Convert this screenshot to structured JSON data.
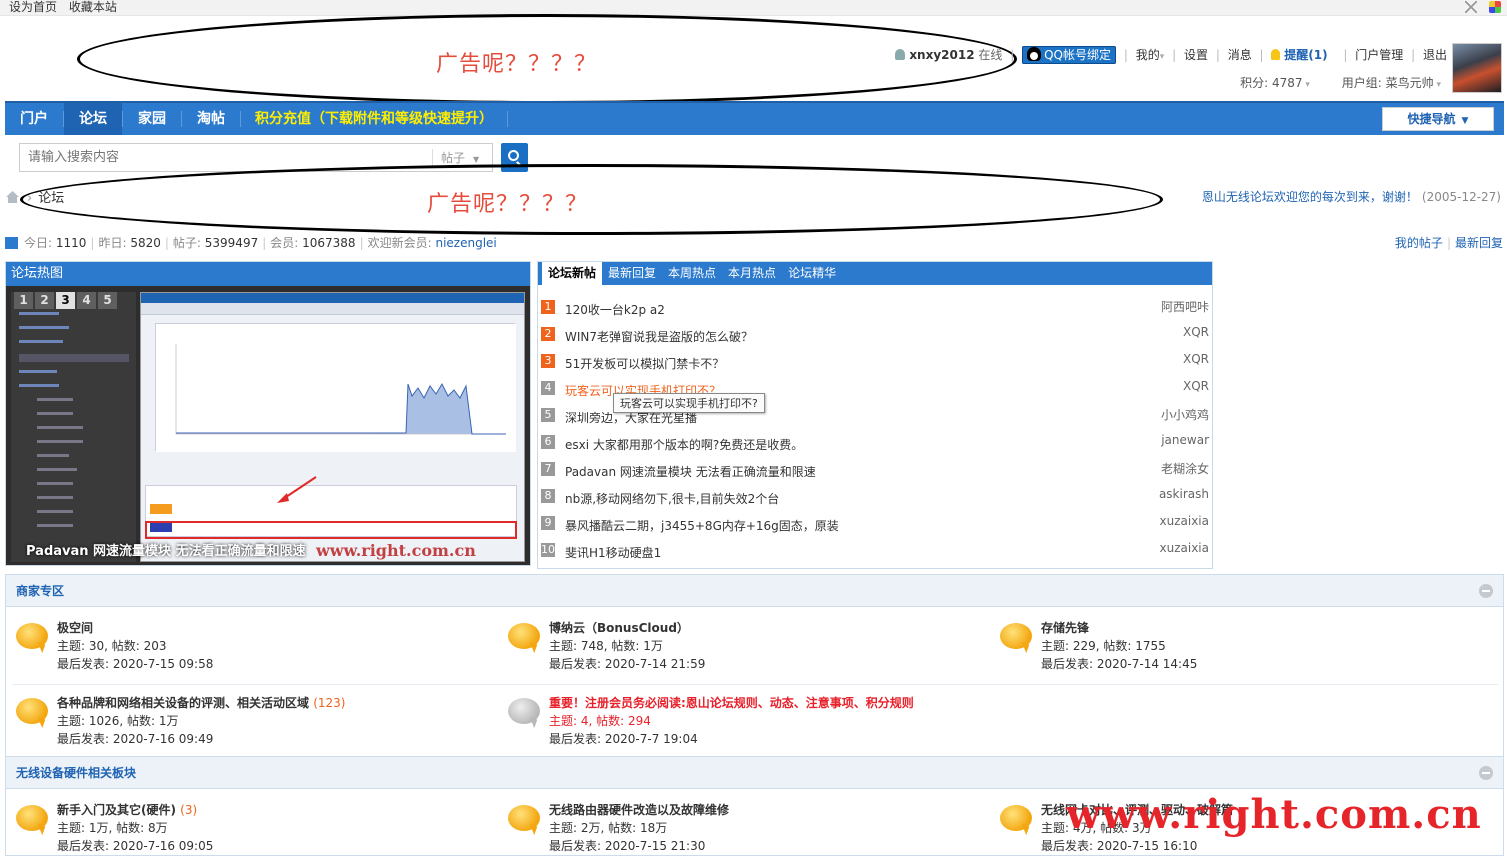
{
  "topbar": {
    "set_home": "设为首页",
    "bookmark": "收藏本站"
  },
  "ads": {
    "header_ad": "广告呢？？？？",
    "breadcrumb_ad": "广告呢？？？？"
  },
  "user": {
    "username": "xnxy2012",
    "status": "在线",
    "qq_bind": "QQ帐号绑定",
    "my": "我的",
    "settings": "设置",
    "messages": "消息",
    "reminder": "提醒(1)",
    "portal_admin": "门户管理",
    "logout": "退出",
    "points": "积分: 4787",
    "group": "用户组: 菜鸟元帅"
  },
  "nav": {
    "items": [
      "门户",
      "论坛",
      "家园",
      "淘帖"
    ],
    "promo": "积分充值（下载附件和等级快速提升）",
    "quick_nav": "快捷导航"
  },
  "search": {
    "placeholder": "请输入搜索内容",
    "type": "帖子"
  },
  "breadcrumb": {
    "current": "论坛"
  },
  "welcome": {
    "message": "恩山无线论坛欢迎您的每次到来，谢谢！",
    "date": "(2005-12-27)"
  },
  "stats": {
    "today_label": "今日: ",
    "today": "1110",
    "yesterday_label": "昨日: ",
    "yesterday": "5820",
    "posts_label": "帖子: ",
    "posts": "5399497",
    "members_label": "会员: ",
    "members": "1067388",
    "newuser_label": "欢迎新会员: ",
    "newuser": "niezenglei",
    "my_posts": "我的帖子",
    "latest_replies": "最新回复"
  },
  "hot": {
    "title": "论坛热图",
    "pages": [
      "1",
      "2",
      "3",
      "4",
      "5"
    ],
    "active_page": "3",
    "caption": "Padavan 网速流量模块 无法看正确流量和限速",
    "watermark": "www.right.com.cn"
  },
  "threads": {
    "tabs": [
      "论坛新帖",
      "最新回复",
      "本周热点",
      "本月热点",
      "论坛精华"
    ],
    "items": [
      {
        "n": "1",
        "title": "120收一台k2p a2",
        "author": "阿西吧咔"
      },
      {
        "n": "2",
        "title": "WIN7老弹窗说我是盗版的怎么破？",
        "author": "XQR"
      },
      {
        "n": "3",
        "title": "51开发板可以模拟门禁卡不？",
        "author": "XQR"
      },
      {
        "n": "4",
        "title": "玩客云可以实现手机打印不？",
        "author": "XQR"
      },
      {
        "n": "5",
        "title": "深圳旁边，大家在光星播",
        "author": "小小鸡鸡"
      },
      {
        "n": "6",
        "title": "esxi 大家都用那个版本的啊?免费还是收费。",
        "author": "janewar"
      },
      {
        "n": "7",
        "title": "Padavan 网速流量模块 无法看正确流量和限速",
        "author": "老糊涂女"
      },
      {
        "n": "8",
        "title": "nb源,移动网络勿下,很卡,目前失效2个台",
        "author": "askirash"
      },
      {
        "n": "9",
        "title": "暴风播酷云二期，j3455+8G内存+16g固态，原装",
        "author": "xuzaixia"
      },
      {
        "n": "10",
        "title": "斐讯H1移动硬盘1",
        "author": "xuzaixia"
      }
    ],
    "tooltip": "玩客云可以实现手机打印不?"
  },
  "group1": {
    "title": "商家专区",
    "forums": [
      {
        "name": "极空间",
        "count": "",
        "stats": "主题: 30, 帖数: 203",
        "last": "最后发表: 2020-7-15 09:58"
      },
      {
        "name": "博纳云（BonusCloud）",
        "count": "",
        "stats": "主题: 748, 帖数: 1万",
        "last": "最后发表: 2020-7-14 21:59"
      },
      {
        "name": "存储先锋",
        "count": "",
        "stats": "主题: 229, 帖数: 1755",
        "last": "最后发表: 2020-7-14 14:45"
      },
      {
        "name": "各种品牌和网络相关设备的评测、相关活动区域",
        "count": "(123)",
        "stats": "主题: 1026, 帖数: 1万",
        "last": "最后发表: 2020-7-16 09:49"
      },
      {
        "name": "重要！注册会员务必阅读:恩山论坛规则、动态、注意事项、积分规则",
        "count": "",
        "stats": "主题: 4, 帖数: 294",
        "last": "最后发表: 2020-7-7 19:04"
      }
    ]
  },
  "group2": {
    "title": "无线设备硬件相关板块",
    "forums": [
      {
        "name": "新手入门及其它(硬件)",
        "count": "(3)",
        "stats": "主题: 1万, 帖数: 8万",
        "last": "最后发表: 2020-7-16 09:05"
      },
      {
        "name": "无线路由器硬件改造以及故障维修",
        "count": "",
        "stats": "主题: 2万, 帖数: 18万",
        "last": "最后发表: 2020-7-15 21:30"
      },
      {
        "name": "无线网卡对比、评测、驱动、破解篇",
        "count": "",
        "stats": "主题: 4万, 帖数: 3万",
        "last": "最后发表: 2020-7-15 16:10"
      }
    ]
  },
  "bottom_watermark": "www.right.com.cn"
}
